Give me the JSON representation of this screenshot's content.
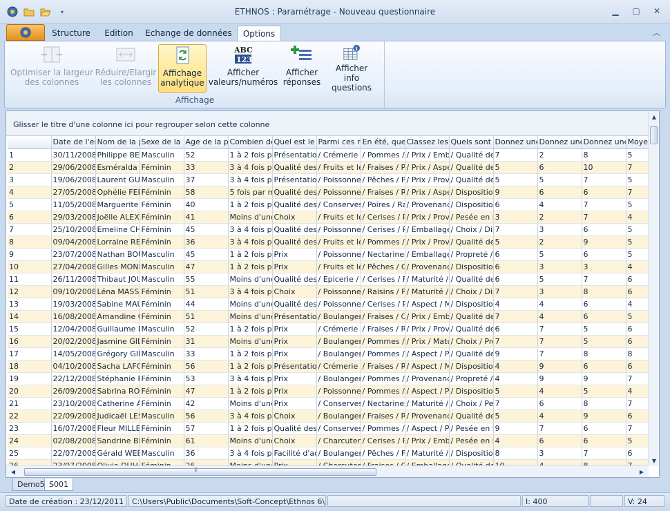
{
  "window": {
    "title": "ETHNOS : Paramétrage - Nouveau questionnaire"
  },
  "tabs": [
    "Structure",
    "Edition",
    "Echange de données",
    "Options"
  ],
  "active_tab": "Options",
  "ribbon": {
    "group_label": "Affichage",
    "buttons": [
      {
        "label1": "Optimiser la largeur",
        "label2": "des colonnes",
        "enabled": false
      },
      {
        "label1": "Réduire/Elargir",
        "label2": "les colonnes",
        "enabled": false
      },
      {
        "label1": "Affichage",
        "label2": "analytique",
        "active": true
      },
      {
        "label1": "Afficher",
        "label2": "valeurs/numéros"
      },
      {
        "label1": "Afficher",
        "label2": "réponses"
      },
      {
        "label1": "Afficher info",
        "label2": "questions"
      }
    ]
  },
  "grid": {
    "group_hint": "Glisser le titre d'une colonne ici pour regrouper selon cette colonne",
    "columns": [
      "",
      "Date de l'enq",
      "Nom de la pe",
      "Sexe de la p",
      "Age de la pe",
      "Combien de",
      "Quel est le p",
      "Parmi ces ra",
      "En été, quel",
      "Classez les c",
      "Quels sont p",
      "Donnez une",
      "Donnez une",
      "Donnez une",
      "Moyer"
    ],
    "rows": [
      [
        "1",
        "30/11/2008",
        "Philippe BERI",
        "Masculin",
        "52",
        "1 à 2 fois pa",
        "Présentation",
        "/ Crémerie /",
        "/ Pommes / N",
        "/ Prix / Emba",
        "/ Qualité des",
        "7",
        "2",
        "8",
        "5"
      ],
      [
        "2",
        "29/06/2008",
        "Esméralda SC",
        "Féminin",
        "33",
        "3 à 4 fois pa",
        "Qualité des p",
        "/ Fruits et lé",
        "/ Fraises / Pê",
        "/ Prix / Aspe",
        "/ Qualité des",
        "5",
        "6",
        "10",
        "7"
      ],
      [
        "3",
        "19/06/2008",
        "Laurent GUII",
        "Masculin",
        "37",
        "3 à 4 fois pa",
        "Présentation",
        "/ Poissonner",
        "/ Pêches / Po",
        "/ Prix / Prove",
        "/ Qualité des",
        "5",
        "5",
        "7",
        "5"
      ],
      [
        "4",
        "27/05/2008",
        "Ophélie FERI",
        "Féminin",
        "58",
        "5 fois par mo",
        "Qualité des p",
        "/ Poissonner",
        "/ Fraises / Ra",
        "/ Prix / Aspe",
        "/ Disposition",
        "9",
        "6",
        "6",
        "7"
      ],
      [
        "5",
        "11/05/2008",
        "Marguerite T",
        "Féminin",
        "40",
        "1 à 2 fois pa",
        "Qualité des p",
        "/ Conserves",
        "/ Poires / Ra",
        "/ Provenanc",
        "/ Disposition",
        "6",
        "4",
        "7",
        "5"
      ],
      [
        "6",
        "29/03/2008",
        "Joëlle ALEXA",
        "Féminin",
        "41",
        "Moins d'une",
        "Choix",
        "/ Fruits et lé",
        "/ Cerises / Po",
        "/ Prix / Prove",
        "/ Pesée en lil",
        "3",
        "2",
        "7",
        "4"
      ],
      [
        "7",
        "25/10/2008",
        "Emeline CHA",
        "Féminin",
        "45",
        "3 à 4 fois pa",
        "Qualité des p",
        "/ Poissonner",
        "/ Cerises / Pe",
        "/ Emballage ,",
        "/ Choix / Dis",
        "7",
        "3",
        "6",
        "5"
      ],
      [
        "8",
        "09/04/2008",
        "Lorraine REC",
        "Féminin",
        "36",
        "3 à 4 fois pa",
        "Qualité des p",
        "/ Fruits et lé",
        "/ Pommes / F",
        "/ Prix / Prove",
        "/ Qualité des",
        "5",
        "2",
        "9",
        "5"
      ],
      [
        "9",
        "23/07/2008",
        "Nathan BOU",
        "Masculin",
        "45",
        "1 à 2 fois pa",
        "Prix",
        "/ Poissonner",
        "/ Nectarines",
        "/ Emballage ,",
        "/ Propreté /",
        "6",
        "5",
        "6",
        "5"
      ],
      [
        "10",
        "27/04/2008",
        "Gilles MONNI",
        "Masculin",
        "47",
        "1 à 2 fois pa",
        "Prix",
        "/ Fruits et lé",
        "/ Pêches / Ce",
        "/ Provenanc",
        "/ Disposition",
        "6",
        "3",
        "3",
        "4"
      ],
      [
        "11",
        "26/11/2008",
        "Thibaut JOU",
        "Masculin",
        "55",
        "Moins d'une",
        "Qualité des p",
        "/ Epicerie / P",
        "/ Cerises / Fr",
        "/ Maturité / F",
        "/ Qualité des",
        "6",
        "5",
        "7",
        "6"
      ],
      [
        "12",
        "09/10/2008",
        "Léna MASSE",
        "Féminin",
        "51",
        "3 à 4 fois pa",
        "Choix",
        "/ Poissonner",
        "/ Raisins / Pê",
        "/ Maturité / E",
        "/ Choix / Dis",
        "7",
        "3",
        "8",
        "6"
      ],
      [
        "13",
        "19/03/2008",
        "Sabine MAUI",
        "Féminin",
        "44",
        "Moins d'une",
        "Qualité des p",
        "/ Poissonner",
        "/ Cerises / Pe",
        "/ Aspect / M",
        "/ Disposition",
        "4",
        "4",
        "6",
        "4"
      ],
      [
        "14",
        "16/08/2008",
        "Amandine GI",
        "Féminin",
        "51",
        "Moins d'une",
        "Présentation",
        "/ Boulangeri",
        "/ Fraises / Ce",
        "/ Prix / Emba",
        "/ Qualité des",
        "7",
        "4",
        "6",
        "5"
      ],
      [
        "15",
        "12/04/2008",
        "Guillaume ET",
        "Masculin",
        "52",
        "1 à 2 fois pa",
        "Prix",
        "/ Crémerie /",
        "/ Fraises / Ra",
        "/ Prix / Prove",
        "/ Qualité des",
        "6",
        "7",
        "5",
        "6"
      ],
      [
        "16",
        "20/02/2008",
        "Jasmine GILE",
        "Féminin",
        "31",
        "Moins d'une",
        "Prix",
        "/ Boulangeri",
        "/ Pommes / F",
        "/ Prix / Matu",
        "/ Choix / Pro",
        "7",
        "7",
        "5",
        "6"
      ],
      [
        "17",
        "14/05/2008",
        "Grégory GILI",
        "Masculin",
        "33",
        "1 à 2 fois pa",
        "Prix",
        "/ Boulangeri",
        "/ Pommes / F",
        "/ Aspect / Pr",
        "/ Qualité des",
        "9",
        "7",
        "8",
        "8"
      ],
      [
        "18",
        "04/10/2008",
        "Sacha LAFOI",
        "Féminin",
        "56",
        "1 à 2 fois pa",
        "Présentation",
        "/ Crémerie /",
        "/ Fraises / Ra",
        "/ Aspect / M",
        "/ Disposition",
        "4",
        "9",
        "6",
        "6"
      ],
      [
        "19",
        "22/12/2008",
        "Stéphanie FI",
        "Féminin",
        "53",
        "3 à 4 fois pa",
        "Prix",
        "/ Boulangeri",
        "/ Pommes / N",
        "/ Provenanc",
        "/ Propreté /",
        "4",
        "9",
        "9",
        "7"
      ],
      [
        "20",
        "26/09/2008",
        "Sabrina ROD",
        "Féminin",
        "47",
        "1 à 2 fois pa",
        "Prix",
        "/ Poissonner",
        "/ Pommes / F",
        "/ Aspect / Pr",
        "/ Disposition",
        "5",
        "4",
        "5",
        "4"
      ],
      [
        "21",
        "23/10/2008",
        "Catherine AI",
        "Féminin",
        "42",
        "Moins d'une",
        "Prix",
        "/ Conserves",
        "/ Nectarines",
        "/ Maturité / A",
        "/ Choix / Pes",
        "7",
        "6",
        "8",
        "7"
      ],
      [
        "22",
        "22/09/2008",
        "Judicaël LES.",
        "Masculin",
        "56",
        "3 à 4 fois pa",
        "Choix",
        "/ Boulangeri",
        "/ Fraises / Ra",
        "/ Provenanc",
        "/ Qualité des",
        "5",
        "4",
        "9",
        "6"
      ],
      [
        "23",
        "16/07/2008",
        "Fleur MILLET",
        "Féminin",
        "57",
        "1 à 2 fois pa",
        "Qualité des p",
        "/ Conserves",
        "/ Pommes / F",
        "/ Aspect / Pr",
        "/ Pesée en lil",
        "9",
        "7",
        "6",
        "7"
      ],
      [
        "24",
        "02/08/2008",
        "Sandrine BE(",
        "Féminin",
        "61",
        "Moins d'une",
        "Choix",
        "/ Charcuteri",
        "/ Cerises / Pe",
        "/ Prix / Emba",
        "/ Pesée en lil",
        "4",
        "6",
        "6",
        "5"
      ],
      [
        "25",
        "22/07/2008",
        "Gérald WEBE",
        "Masculin",
        "36",
        "3 à 4 fois pa",
        "Facilité d'acc",
        "/ Boulangeri",
        "/ Pêches / Fr",
        "/ Maturité / A",
        "/ Disposition",
        "8",
        "3",
        "7",
        "6"
      ],
      [
        "26",
        "23/07/2008",
        "Olivia DUHAI",
        "Féminin",
        "26",
        "Moins d'une",
        "Prix",
        "/ Charcuteri",
        "/ Fraises / Ce",
        "/ Emballage ,",
        "/ Qualité des",
        "10",
        "4",
        "8",
        "7"
      ]
    ]
  },
  "sheet_tabs": [
    "Demo5",
    "S001"
  ],
  "active_sheet": "S001",
  "status": {
    "created": "Date de création : 23/12/2011",
    "path": "C:\\Users\\Public\\Documents\\Soft-Concept\\Ethnos 6\\Demo\\",
    "count_i": "I: 400",
    "count_v": "V: 24"
  }
}
